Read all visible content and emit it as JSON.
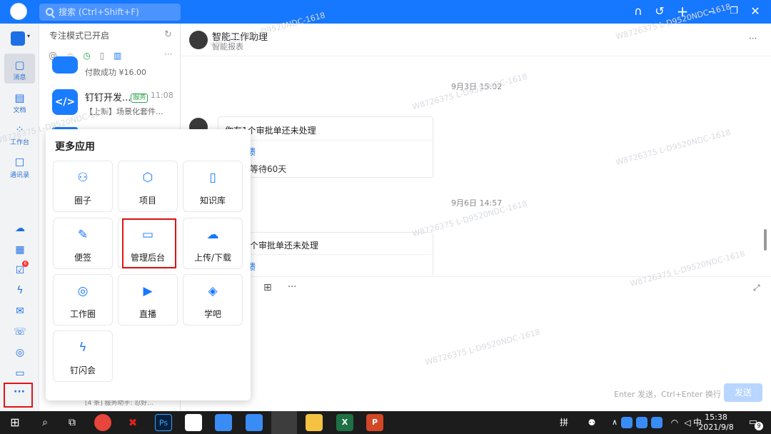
{
  "topbar": {
    "search_placeholder": "搜索 (Ctrl+Shift+F)",
    "icons": [
      "headset-icon",
      "history-icon",
      "plus-icon",
      "minimize-icon",
      "restore-icon",
      "close-icon"
    ]
  },
  "rail": {
    "items": [
      {
        "label": "消息",
        "icon": "message-icon"
      },
      {
        "label": "文档",
        "icon": "document-icon"
      },
      {
        "label": "工作台",
        "icon": "workbench-icon"
      },
      {
        "label": "通讯录",
        "icon": "contacts-icon"
      }
    ],
    "todo_badge": "6"
  },
  "list": {
    "focus_text": "专注模式已开启",
    "item0": {
      "sub": "付款成功 ¥16.00"
    },
    "item1": {
      "name": "钉钉开发...",
      "badge": "服务",
      "time": "11:08",
      "sub": "【上新】场景化套件..."
    },
    "bottom_preview": "[4 条] 服务助手: 忍好..."
  },
  "chat": {
    "title": "智能工作助理",
    "subtitle": "智能报表",
    "date1": "9月3日 15:02",
    "card1": {
      "title": "你有1个审批单还未处理",
      "link": "馈",
      "text": "等待60天"
    },
    "date2": "9月6日 14:57",
    "card2": {
      "title": "个审批单还未处理",
      "link": "馈"
    },
    "hint": "Enter 发送，Ctrl+Enter 换行",
    "send": "发送"
  },
  "popup": {
    "title": "更多应用",
    "apps": [
      {
        "label": "圈子",
        "icon": "circle-group-icon"
      },
      {
        "label": "项目",
        "icon": "project-icon"
      },
      {
        "label": "知识库",
        "icon": "knowledge-base-icon"
      },
      {
        "label": "便签",
        "icon": "note-icon"
      },
      {
        "label": "管理后台",
        "icon": "admin-console-icon"
      },
      {
        "label": "上传/下载",
        "icon": "upload-download-icon"
      },
      {
        "label": "工作圈",
        "icon": "work-circle-icon"
      },
      {
        "label": "直播",
        "icon": "live-icon"
      },
      {
        "label": "学吧",
        "icon": "learn-icon"
      },
      {
        "label": "钉闪会",
        "icon": "flash-meeting-icon"
      }
    ]
  },
  "taskbar": {
    "time": "15:38",
    "date": "2021/9/8",
    "notif_count": "9",
    "apps": [
      "chrome-icon",
      "xmind-icon",
      "photoshop-icon",
      "app-icon",
      "dingtalk-icon",
      "dingtalk-icon",
      "dingtalk-active-icon",
      "folder-icon",
      "excel-icon",
      "powerpoint-icon"
    ]
  },
  "watermark": "W8726375 L-D9520NDC-1618"
}
